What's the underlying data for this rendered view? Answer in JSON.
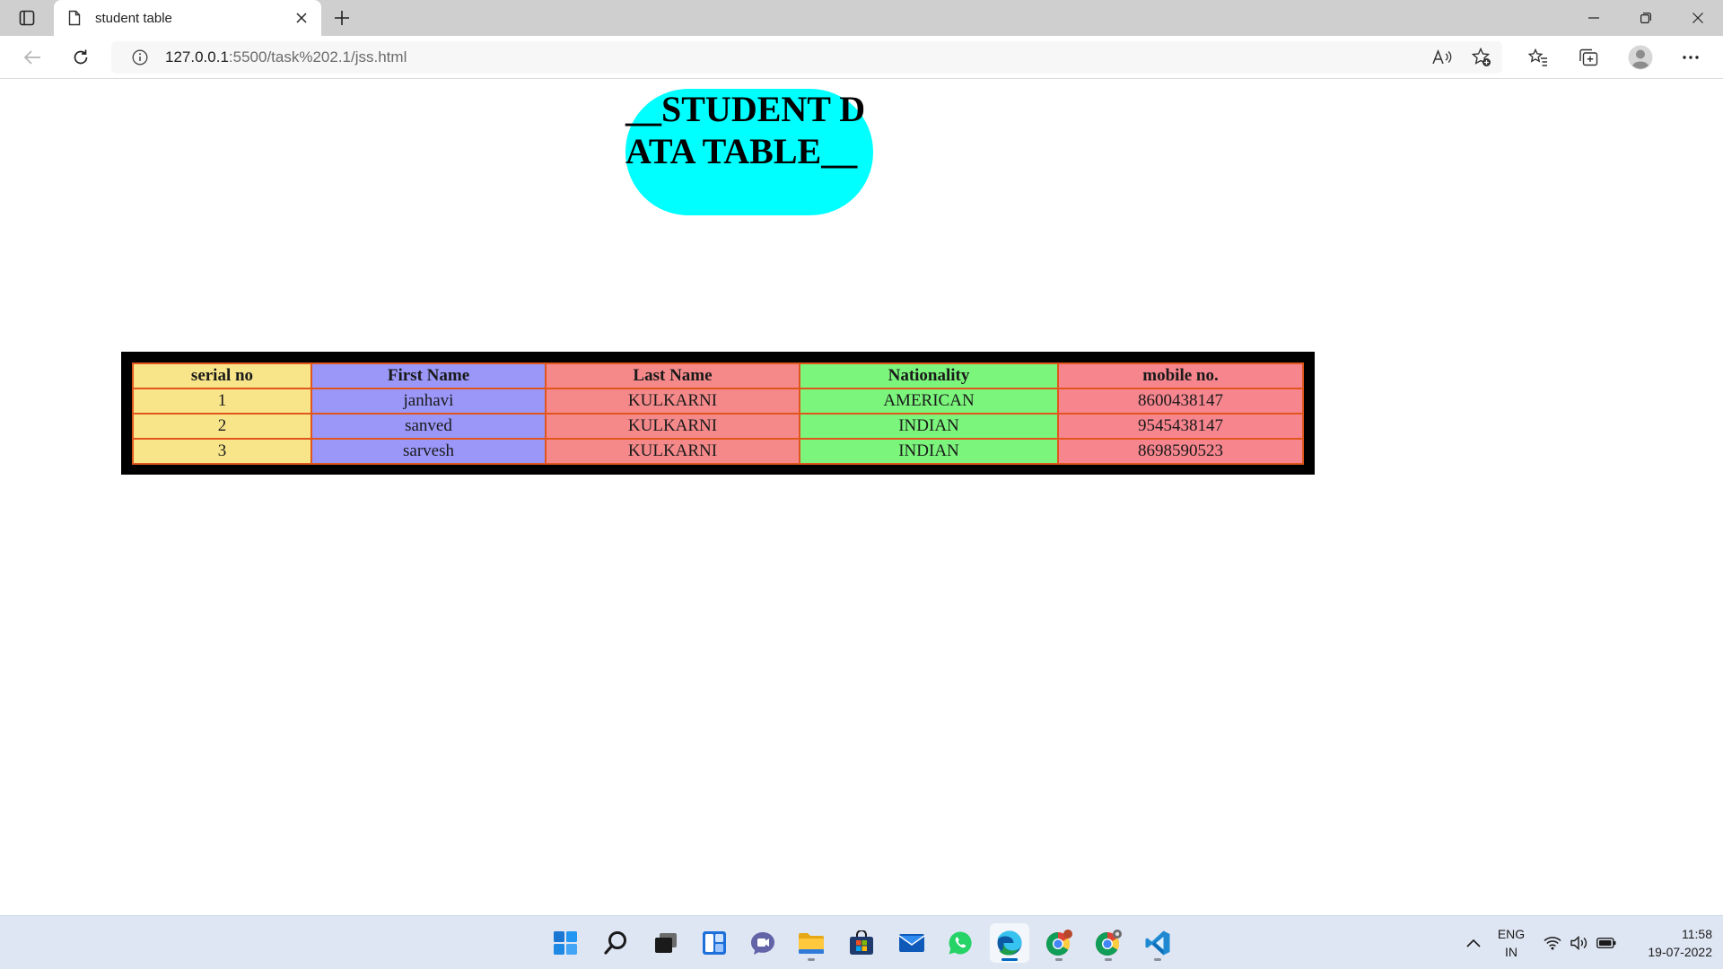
{
  "browser": {
    "tab_title": "student table",
    "url_host": "127.0.0.1",
    "url_rest": ":5500/task%202.1/jss.html"
  },
  "page": {
    "title": "__STUDENT DATA TABLE__",
    "title_bg": "#00ffff"
  },
  "table": {
    "headers": [
      "serial no",
      "First Name",
      "Last Name",
      "Nationality",
      "mobile no."
    ],
    "rows": [
      [
        "1",
        "janhavi",
        "KULKARNI",
        "AMERICAN",
        "8600438147"
      ],
      [
        "2",
        "sanved",
        "KULKARNI",
        "INDIAN",
        "9545438147"
      ],
      [
        "3",
        "sarvesh",
        "KULKARNI",
        "INDIAN",
        "8698590523"
      ]
    ],
    "column_colors": [
      "#f8e58a",
      "#9a97f8",
      "#f5898a",
      "#7bf57b",
      "#f7858e"
    ],
    "border_color": "#e0561c"
  },
  "taskbar": {
    "apps": [
      "start-icon",
      "search-icon",
      "task-view-icon",
      "widgets-icon",
      "teams-chat-icon",
      "file-explorer-icon",
      "microsoft-store-icon",
      "mail-icon",
      "whatsapp-icon",
      "edge-icon",
      "chrome-icon",
      "chrome-profile-icon",
      "vscode-icon"
    ],
    "lang_line1": "ENG",
    "lang_line2": "IN",
    "time": "11:58",
    "date": "19-07-2022"
  }
}
